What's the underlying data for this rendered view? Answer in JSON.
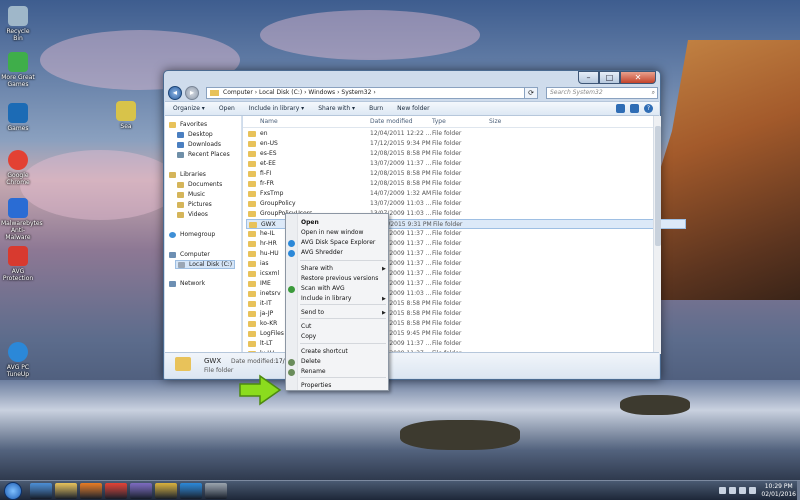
{
  "desktop": {
    "icons": [
      {
        "label": "Recycle Bin",
        "icon": "recycle-bin-icon",
        "color": "#9fb7c9"
      },
      {
        "label": "More Great Games",
        "icon": "games-icon",
        "color": "#3fae4a"
      },
      {
        "label": "Games",
        "icon": "big-fish-icon",
        "color": "#1c6bb5"
      },
      {
        "label": "Google Chrome",
        "icon": "chrome-icon",
        "color": "#e34133"
      },
      {
        "label": "Malwarebytes Anti-Malware",
        "icon": "malwarebytes-icon",
        "color": "#2a6cd4"
      },
      {
        "label": "AVG Protection",
        "icon": "avg-icon",
        "color": "#d83a2f"
      },
      {
        "label": "AVG PC TuneUp",
        "icon": "tuneup-icon",
        "color": "#2b88d8"
      },
      {
        "label": "Sea",
        "icon": "file-icon",
        "color": "#d8c34a"
      }
    ]
  },
  "window": {
    "breadcrumb": "Computer › Local Disk (C:) › Windows › System32 ›",
    "search_placeholder": "Search System32",
    "toolbar": [
      "Organize ▾",
      "Open",
      "Include in library ▾",
      "Share with ▾",
      "Burn",
      "New folder"
    ],
    "nav": {
      "favorites": "Favorites",
      "desktop": "Desktop",
      "downloads": "Downloads",
      "recent": "Recent Places",
      "libraries": "Libraries",
      "documents": "Documents",
      "music": "Music",
      "pictures": "Pictures",
      "videos": "Videos",
      "homegroup": "Homegroup",
      "computer": "Computer",
      "localdisk": "Local Disk (C:)",
      "network": "Network"
    },
    "columns": {
      "name": "Name",
      "date": "Date modified",
      "type": "Type",
      "size": "Size"
    },
    "rows": [
      {
        "name": "en",
        "date": "12/04/2011 12:22 ...",
        "type": "File folder"
      },
      {
        "name": "en-US",
        "date": "17/12/2015 9:34 PM",
        "type": "File folder"
      },
      {
        "name": "es-ES",
        "date": "12/08/2015 8:58 PM",
        "type": "File folder"
      },
      {
        "name": "et-EE",
        "date": "13/07/2009 11:37 ...",
        "type": "File folder"
      },
      {
        "name": "fi-FI",
        "date": "12/08/2015 8:58 PM",
        "type": "File folder"
      },
      {
        "name": "fr-FR",
        "date": "12/08/2015 8:58 PM",
        "type": "File folder"
      },
      {
        "name": "FxsTmp",
        "date": "14/07/2009 1:32 AM",
        "type": "File folder"
      },
      {
        "name": "GroupPolicy",
        "date": "13/07/2009 11:03 ...",
        "type": "File folder"
      },
      {
        "name": "GroupPolicyUsers",
        "date": "13/07/2009 11:03 ...",
        "type": "File folder"
      },
      {
        "name": "GWX",
        "date": "17/12/2015 9:31 PM",
        "type": "File folder"
      },
      {
        "name": "he-IL",
        "date": "13/07/2009 11:37 ...",
        "type": "File folder"
      },
      {
        "name": "hr-HR",
        "date": "13/07/2009 11:37 ...",
        "type": "File folder"
      },
      {
        "name": "hu-HU",
        "date": "13/07/2009 11:37 ...",
        "type": "File folder"
      },
      {
        "name": "ias",
        "date": "13/07/2009 11:37 ...",
        "type": "File folder"
      },
      {
        "name": "icsxml",
        "date": "13/07/2009 11:37 ...",
        "type": "File folder"
      },
      {
        "name": "IME",
        "date": "13/07/2009 11:37 ...",
        "type": "File folder"
      },
      {
        "name": "inetsrv",
        "date": "13/07/2009 11:03 ...",
        "type": "File folder"
      },
      {
        "name": "it-IT",
        "date": "12/08/2015 8:58 PM",
        "type": "File folder"
      },
      {
        "name": "ja-JP",
        "date": "12/08/2015 8:58 PM",
        "type": "File folder"
      },
      {
        "name": "ko-KR",
        "date": "12/08/2015 8:58 PM",
        "type": "File folder"
      },
      {
        "name": "LogFiles",
        "date": "12/08/2015 9:45 PM",
        "type": "File folder"
      },
      {
        "name": "lt-LT",
        "date": "13/07/2009 11:37 ...",
        "type": "File folder"
      },
      {
        "name": "lv-LV",
        "date": "13/07/2009 11:37 ...",
        "type": "File folder"
      }
    ],
    "selected_row": "GWX",
    "details": {
      "name": "GWX",
      "modified_label": "Date modified:",
      "modified_value": "17/12/",
      "type": "File folder"
    }
  },
  "context_menu": {
    "items": [
      {
        "label": "Open",
        "bold": true
      },
      {
        "label": "Open in new window"
      },
      {
        "label": "AVG Disk Space Explorer",
        "icon": "avg-disk-icon",
        "icon_color": "#2b88d8"
      },
      {
        "label": "AVG Shredder",
        "icon": "avg-shredder-icon",
        "icon_color": "#2b88d8"
      },
      {
        "label": "Share with",
        "submenu": true
      },
      {
        "label": "Restore previous versions"
      },
      {
        "label": "Scan with AVG",
        "icon": "avg-scan-icon",
        "icon_color": "#3b9a3b"
      },
      {
        "label": "Include in library",
        "submenu": true
      },
      {
        "label": "Send to",
        "submenu": true
      },
      {
        "label": "Cut"
      },
      {
        "label": "Copy"
      },
      {
        "label": "Create shortcut"
      },
      {
        "label": "Delete",
        "icon": "shield-icon",
        "icon_color": "#6a8c5a"
      },
      {
        "label": "Rename",
        "icon": "shield-icon",
        "icon_color": "#6a8c5a"
      },
      {
        "label": "Properties"
      }
    ]
  },
  "annotation_color": "#8bdc1e",
  "taskbar": {
    "apps": [
      {
        "icon": "ie-icon",
        "color": "#4b8ed6"
      },
      {
        "icon": "explorer-icon",
        "color": "#e8c25a"
      },
      {
        "icon": "media-player-icon",
        "color": "#e97b22"
      },
      {
        "icon": "chrome-icon",
        "color": "#e34133"
      },
      {
        "icon": "app-icon",
        "color": "#7d6ac0"
      },
      {
        "icon": "game-icon",
        "color": "#d9b13c"
      },
      {
        "icon": "tuneup-icon",
        "color": "#2b88d8"
      },
      {
        "icon": "avg-icon",
        "color": "#9aa3ad"
      }
    ],
    "time": "10:29 PM",
    "date": "02/01/2016"
  }
}
